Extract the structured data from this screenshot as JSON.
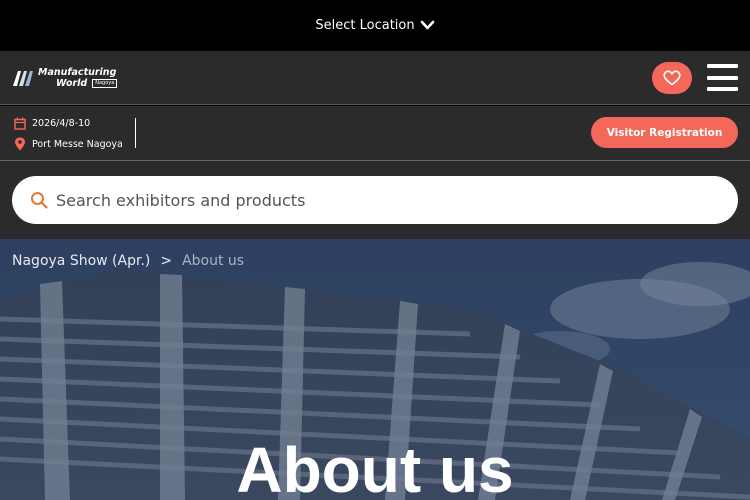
{
  "top_bar": {
    "location_label": "Select Location"
  },
  "header": {
    "logo": {
      "line1": "Manufacturing",
      "line2": "World",
      "sub": "Nagoya"
    }
  },
  "event_info": {
    "date": "2026/4/8-10",
    "venue": "Port Messe Nagoya",
    "visitor_button": "Visitor Registration"
  },
  "search": {
    "placeholder": "Search exhibitors and products"
  },
  "breadcrumb": {
    "parent": "Nagoya Show (Apr.)",
    "separator": ">",
    "current": "About us"
  },
  "hero": {
    "title": "About us"
  },
  "colors": {
    "accent": "#f4685a",
    "header_bg": "#2b2b2b",
    "top_bar_bg": "#000000"
  }
}
